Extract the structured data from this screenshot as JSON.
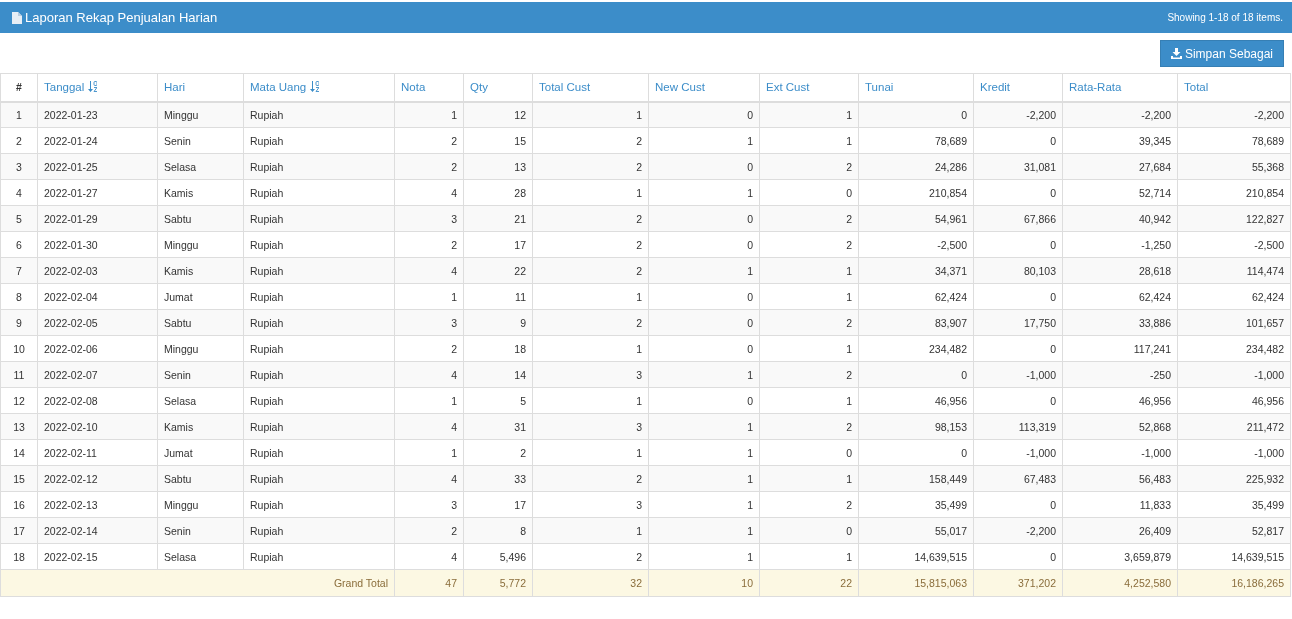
{
  "panel": {
    "title": "Laporan Rekap Penjualan Harian",
    "summary": "Showing 1-18 of 18 items."
  },
  "save_button": {
    "label": "Simpan Sebagai"
  },
  "table": {
    "columns": [
      {
        "label": "#",
        "sort_icon": false,
        "kind": "index"
      },
      {
        "label": "Tanggal",
        "sort_icon": true,
        "kind": "text"
      },
      {
        "label": "Hari",
        "sort_icon": false,
        "kind": "text"
      },
      {
        "label": "Mata Uang",
        "sort_icon": true,
        "kind": "text"
      },
      {
        "label": "Nota",
        "sort_icon": false,
        "kind": "number"
      },
      {
        "label": "Qty",
        "sort_icon": false,
        "kind": "number"
      },
      {
        "label": "Total Cust",
        "sort_icon": false,
        "kind": "number"
      },
      {
        "label": "New Cust",
        "sort_icon": false,
        "kind": "number"
      },
      {
        "label": "Ext Cust",
        "sort_icon": false,
        "kind": "number"
      },
      {
        "label": "Tunai",
        "sort_icon": false,
        "kind": "number"
      },
      {
        "label": "Kredit",
        "sort_icon": false,
        "kind": "number"
      },
      {
        "label": "Rata-Rata",
        "sort_icon": false,
        "kind": "number"
      },
      {
        "label": "Total",
        "sort_icon": false,
        "kind": "number"
      }
    ],
    "rows": [
      [
        "1",
        "2022-01-23",
        "Minggu",
        "Rupiah",
        "1",
        "12",
        "1",
        "0",
        "1",
        "0",
        "-2,200",
        "-2,200",
        "-2,200"
      ],
      [
        "2",
        "2022-01-24",
        "Senin",
        "Rupiah",
        "2",
        "15",
        "2",
        "1",
        "1",
        "78,689",
        "0",
        "39,345",
        "78,689"
      ],
      [
        "3",
        "2022-01-25",
        "Selasa",
        "Rupiah",
        "2",
        "13",
        "2",
        "0",
        "2",
        "24,286",
        "31,081",
        "27,684",
        "55,368"
      ],
      [
        "4",
        "2022-01-27",
        "Kamis",
        "Rupiah",
        "4",
        "28",
        "1",
        "1",
        "0",
        "210,854",
        "0",
        "52,714",
        "210,854"
      ],
      [
        "5",
        "2022-01-29",
        "Sabtu",
        "Rupiah",
        "3",
        "21",
        "2",
        "0",
        "2",
        "54,961",
        "67,866",
        "40,942",
        "122,827"
      ],
      [
        "6",
        "2022-01-30",
        "Minggu",
        "Rupiah",
        "2",
        "17",
        "2",
        "0",
        "2",
        "-2,500",
        "0",
        "-1,250",
        "-2,500"
      ],
      [
        "7",
        "2022-02-03",
        "Kamis",
        "Rupiah",
        "4",
        "22",
        "2",
        "1",
        "1",
        "34,371",
        "80,103",
        "28,618",
        "114,474"
      ],
      [
        "8",
        "2022-02-04",
        "Jumat",
        "Rupiah",
        "1",
        "11",
        "1",
        "0",
        "1",
        "62,424",
        "0",
        "62,424",
        "62,424"
      ],
      [
        "9",
        "2022-02-05",
        "Sabtu",
        "Rupiah",
        "3",
        "9",
        "2",
        "0",
        "2",
        "83,907",
        "17,750",
        "33,886",
        "101,657"
      ],
      [
        "10",
        "2022-02-06",
        "Minggu",
        "Rupiah",
        "2",
        "18",
        "1",
        "0",
        "1",
        "234,482",
        "0",
        "117,241",
        "234,482"
      ],
      [
        "11",
        "2022-02-07",
        "Senin",
        "Rupiah",
        "4",
        "14",
        "3",
        "1",
        "2",
        "0",
        "-1,000",
        "-250",
        "-1,000"
      ],
      [
        "12",
        "2022-02-08",
        "Selasa",
        "Rupiah",
        "1",
        "5",
        "1",
        "0",
        "1",
        "46,956",
        "0",
        "46,956",
        "46,956"
      ],
      [
        "13",
        "2022-02-10",
        "Kamis",
        "Rupiah",
        "4",
        "31",
        "3",
        "1",
        "2",
        "98,153",
        "113,319",
        "52,868",
        "211,472"
      ],
      [
        "14",
        "2022-02-11",
        "Jumat",
        "Rupiah",
        "1",
        "2",
        "1",
        "1",
        "0",
        "0",
        "-1,000",
        "-1,000",
        "-1,000"
      ],
      [
        "15",
        "2022-02-12",
        "Sabtu",
        "Rupiah",
        "4",
        "33",
        "2",
        "1",
        "1",
        "158,449",
        "67,483",
        "56,483",
        "225,932"
      ],
      [
        "16",
        "2022-02-13",
        "Minggu",
        "Rupiah",
        "3",
        "17",
        "3",
        "1",
        "2",
        "35,499",
        "0",
        "11,833",
        "35,499"
      ],
      [
        "17",
        "2022-02-14",
        "Senin",
        "Rupiah",
        "2",
        "8",
        "1",
        "1",
        "0",
        "55,017",
        "-2,200",
        "26,409",
        "52,817"
      ],
      [
        "18",
        "2022-02-15",
        "Selasa",
        "Rupiah",
        "4",
        "5,496",
        "2",
        "1",
        "1",
        "14,639,515",
        "0",
        "3,659,879",
        "14,639,515"
      ]
    ],
    "footer": {
      "label": "Grand Total",
      "values": [
        "47",
        "5,772",
        "32",
        "10",
        "22",
        "15,815,063",
        "371,202",
        "4,252,580",
        "16,186,265"
      ]
    }
  }
}
